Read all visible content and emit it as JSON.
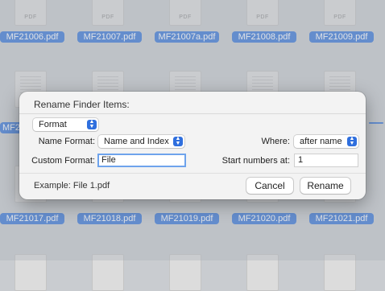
{
  "files": {
    "row1": [
      "MF21006.pdf",
      "MF21007.pdf",
      "MF21007a.pdf",
      "MF21008.pdf",
      "MF21009.pdf"
    ],
    "row2_partial": "MF2",
    "row3": [
      "MF21017.pdf",
      "MF21018.pdf",
      "MF21019.pdf",
      "MF21020.pdf",
      "MF21021.pdf"
    ],
    "thumb_text": "PDF"
  },
  "dialog": {
    "title": "Rename Finder Items:",
    "mode_popup": "Format",
    "name_format_label": "Name Format:",
    "name_format_value": "Name and Index",
    "where_label": "Where:",
    "where_value": "after name",
    "custom_format_label": "Custom Format:",
    "custom_format_value": "File",
    "start_numbers_label": "Start numbers at:",
    "start_numbers_value": "1",
    "example": "Example: File 1.pdf",
    "cancel_label": "Cancel",
    "rename_label": "Rename"
  },
  "colors": {
    "accent": "#2f6fde",
    "selection": "#3f7bd9",
    "focus_ring": "#6ea3ec"
  }
}
